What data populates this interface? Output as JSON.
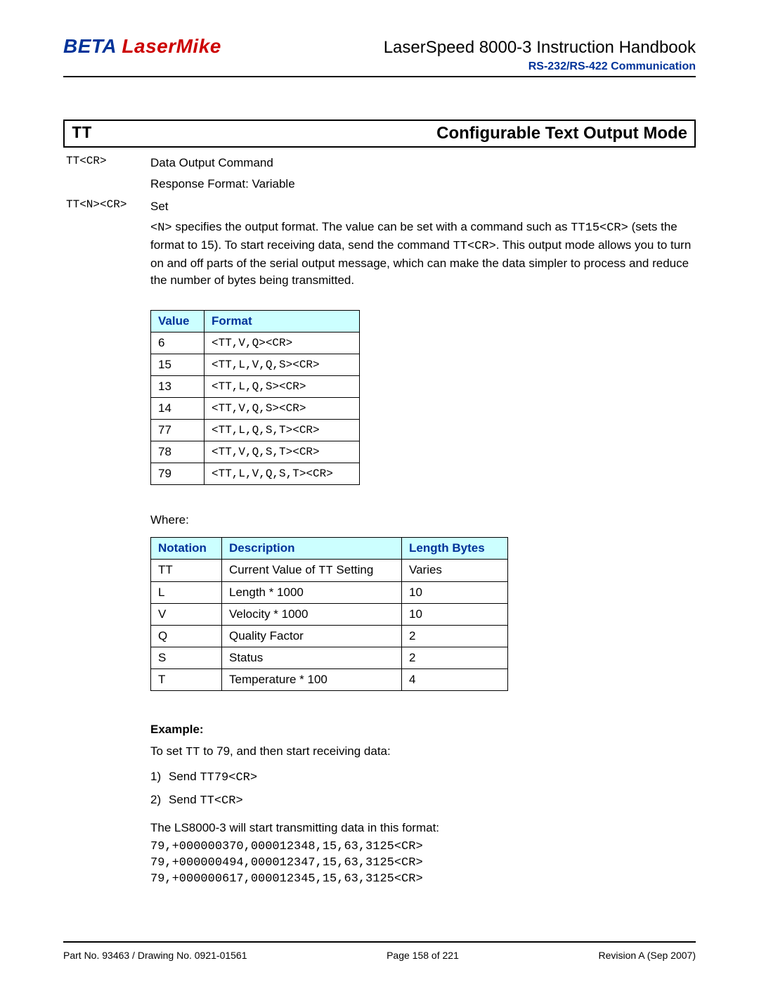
{
  "header": {
    "logo_beta": "BETA",
    "logo_lm": "LaserMike",
    "doc_title": "LaserSpeed 8000-3 Instruction Handbook",
    "subheader": "RS-232/RS-422 Communication"
  },
  "section": {
    "code": "TT",
    "title": "Configurable Text Output Mode"
  },
  "defs": {
    "cmd1": {
      "term": "TT<CR>",
      "line1": "Data Output Command",
      "line2": "Response Format: Variable"
    },
    "cmd2": {
      "term": "TT<N><CR>",
      "line1": "Set",
      "para_pre": "<N>",
      "para_mid1": " specifies the output format.  The value can be set with a command such as ",
      "para_code1": "TT15<CR>",
      "para_mid2": " (sets the format to 15).  To start receiving data, send the command ",
      "para_code2": "TT<CR>",
      "para_tail": ".  This output mode allows you to turn on and off parts of the serial output message, which can make the data simpler to process and reduce the number of bytes being transmitted."
    }
  },
  "table1": {
    "h1": "Value",
    "h2": "Format",
    "rows": [
      {
        "v": "6",
        "f": "<TT,V,Q><CR>"
      },
      {
        "v": "15",
        "f": "<TT,L,V,Q,S><CR>"
      },
      {
        "v": "13",
        "f": "<TT,L,Q,S><CR>"
      },
      {
        "v": "14",
        "f": "<TT,V,Q,S><CR>"
      },
      {
        "v": "77",
        "f": "<TT,L,Q,S,T><CR>"
      },
      {
        "v": "78",
        "f": "<TT,V,Q,S,T><CR>"
      },
      {
        "v": "79",
        "f": "<TT,L,V,Q,S,T><CR>"
      }
    ]
  },
  "where_label": "Where:",
  "table2": {
    "h1": "Notation",
    "h2": "Description",
    "h3": "Length Bytes",
    "rows": [
      {
        "n": "TT",
        "d_pre": "Current Value of ",
        "d_code": "TT",
        "d_post": " Setting",
        "l": "Varies"
      },
      {
        "n": "L",
        "d_pre": "Length * 1000",
        "d_code": "",
        "d_post": "",
        "l": "10"
      },
      {
        "n": "V",
        "d_pre": "Velocity * 1000",
        "d_code": "",
        "d_post": "",
        "l": "10"
      },
      {
        "n": "Q",
        "d_pre": "Quality Factor",
        "d_code": "",
        "d_post": "",
        "l": "2"
      },
      {
        "n": "S",
        "d_pre": "Status",
        "d_code": "",
        "d_post": "",
        "l": "2"
      },
      {
        "n": "T",
        "d_pre": "Temperature * 100",
        "d_code": "",
        "d_post": "",
        "l": "4"
      }
    ]
  },
  "example": {
    "label": "Example:",
    "intro_pre": "To set ",
    "intro_code": "TT",
    "intro_post": " to 79, and then start receiving data:",
    "steps": [
      {
        "num": "1)",
        "pre": "Send ",
        "code": "TT79<CR>"
      },
      {
        "num": "2)",
        "pre": "Send ",
        "code": "TT<CR>"
      }
    ],
    "result_line": "The LS8000-3 will start transmitting data in this format:",
    "output": [
      "79,+000000370,000012348,15,63,3125<CR>",
      "79,+000000494,000012347,15,63,3125<CR>",
      "79,+000000617,000012345,15,63,3125<CR>"
    ]
  },
  "footer": {
    "left": "Part No. 93463 / Drawing No. 0921-01561",
    "center": "Page 158 of 221",
    "right": "Revision A (Sep 2007)"
  }
}
